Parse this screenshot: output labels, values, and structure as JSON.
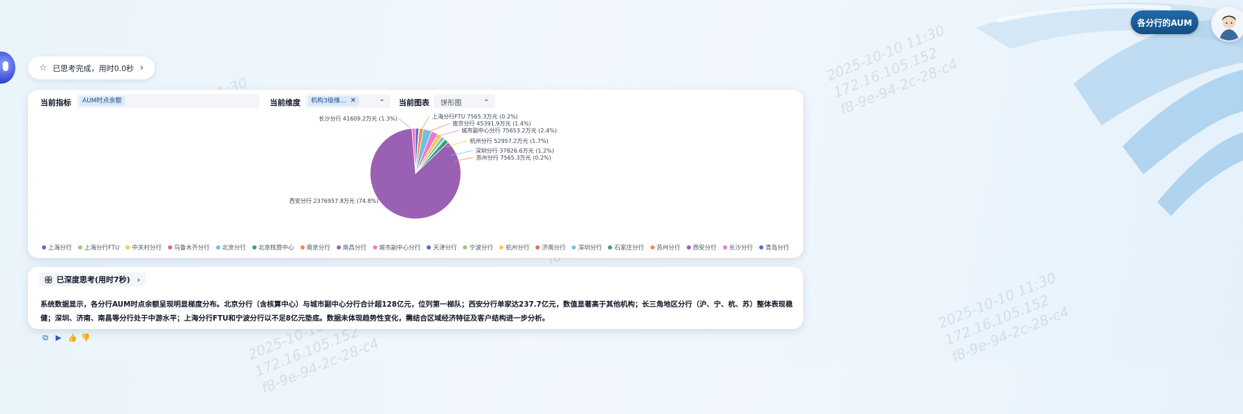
{
  "header": {
    "aum_button": "各分行的AUM"
  },
  "watermark": {
    "lines": [
      "2025-10-10 11:30",
      "172.16.105.152",
      "f8-9e-94-2c-28-c4"
    ]
  },
  "thinking": {
    "label": "已思考完成，用时0.0秒"
  },
  "toolbar": {
    "metric_label": "当前指标",
    "metric_value": "AUM时点余额",
    "dimension_label": "当前维度",
    "dimension_value": "机构3级维...",
    "chart_label": "当前图表",
    "chart_value": "饼形图"
  },
  "chart_data": {
    "type": "pie",
    "unit": "万元",
    "slices": [
      {
        "name": "上海分行",
        "value": null,
        "color": "#5470c6"
      },
      {
        "name": "上海分行FTU",
        "value": 7565.3,
        "pct": 0.2,
        "color": "#91cc75"
      },
      {
        "name": "中关村分行",
        "value": null,
        "color": "#fac858"
      },
      {
        "name": "乌鲁木齐分行",
        "value": null,
        "color": "#ee6666"
      },
      {
        "name": "北京分行",
        "value": null,
        "color": "#73c0de"
      },
      {
        "name": "北京核算中心",
        "value": null,
        "color": "#3ba272"
      },
      {
        "name": "南京分行",
        "value": 45391.9,
        "pct": 1.4,
        "color": "#fc8452"
      },
      {
        "name": "南昌分行",
        "value": null,
        "color": "#9a60b4"
      },
      {
        "name": "城市副中心分行",
        "value": 75653.2,
        "pct": 2.4,
        "color": "#ea7ccc"
      },
      {
        "name": "天津分行",
        "value": null,
        "color": "#5470c6"
      },
      {
        "name": "宁波分行",
        "value": null,
        "color": "#91cc75"
      },
      {
        "name": "杭州分行",
        "value": 52957.2,
        "pct": 1.7,
        "color": "#fac858"
      },
      {
        "name": "济南分行",
        "value": null,
        "color": "#ee6666"
      },
      {
        "name": "深圳分行",
        "value": 37826.6,
        "pct": 1.2,
        "color": "#73c0de"
      },
      {
        "name": "石家庄分行",
        "value": null,
        "color": "#3ba272"
      },
      {
        "name": "苏州分行",
        "value": 7565.3,
        "pct": 0.2,
        "color": "#fc8452"
      },
      {
        "name": "西安分行",
        "value": 2376957.8,
        "pct": 74.8,
        "color": "#9a60b4"
      },
      {
        "name": "长沙分行",
        "value": 41609.2,
        "pct": 1.3,
        "color": "#ea7ccc"
      },
      {
        "name": "青岛分行",
        "value": null,
        "color": "#5470c6"
      }
    ],
    "labels": [
      {
        "text": "长沙分行 41609.2万元 (1.3%)",
        "color": "#ea7ccc"
      },
      {
        "text": "上海分行FTU 7565.3万元 (0.2%)",
        "color": "#91cc75"
      },
      {
        "text": "南京分行 45391.9万元 (1.4%)",
        "color": "#fc8452"
      },
      {
        "text": "城市副中心分行 75653.2万元 (2.4%)",
        "color": "#ea7ccc"
      },
      {
        "text": "杭州分行 52957.2万元 (1.7%)",
        "color": "#fac858"
      },
      {
        "text": "深圳分行 37826.6万元 (1.2%)",
        "color": "#73c0de"
      },
      {
        "text": "苏州分行 7565.3万元 (0.2%)",
        "color": "#fc8452"
      },
      {
        "text": "西安分行 2376957.8万元 (74.8%)",
        "color": "#9a60b4"
      }
    ]
  },
  "deep_think": {
    "label": "已深度思考(用时7秒)"
  },
  "summary": {
    "text": "系统数据显示，各分行AUM时点余额呈现明显梯度分布。北京分行（含核算中心）与城市副中心分行合计超128亿元，位列第一梯队；西安分行单家达237.7亿元，数值显著高于其他机构；长三角地区分行（沪、宁、杭、苏）整体表现稳健；深圳、济南、南昌等分行处于中游水平；上海分行FTU和宁波分行以不足8亿元垫底。数据未体现趋势性变化，需结合区域经济特征及客户结构进一步分析。"
  },
  "bottom": {
    "text": "~ ~ ~"
  }
}
